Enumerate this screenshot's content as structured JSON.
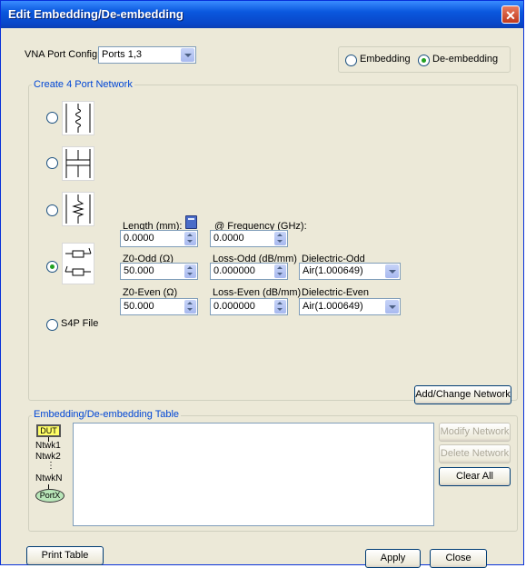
{
  "window": {
    "title": "Edit Embedding/De-embedding",
    "close_glyph": "✕"
  },
  "port_config": {
    "label": "VNA Port Config",
    "value": "Ports 1,3"
  },
  "mode": {
    "embedding_label": "Embedding",
    "deembedding_label": "De-embedding",
    "selected": "De-embedding"
  },
  "create_group": {
    "title": "Create 4 Port Network"
  },
  "topologies": [
    {
      "name": "series-inductor",
      "selected": false
    },
    {
      "name": "shunt-capacitor",
      "selected": false
    },
    {
      "name": "shunt-inductor",
      "selected": false
    },
    {
      "name": "coupled-line",
      "selected": true
    }
  ],
  "s4p_label": "S4P File",
  "fields": {
    "length_label": "Length (mm):",
    "length_value": "0.0000",
    "frequency_label": "@ Frequency (GHz):",
    "frequency_value": "0.0000",
    "z0_odd_label": "Z0-Odd (Ω)",
    "z0_odd_value": "50.000",
    "loss_odd_label": "Loss-Odd (dB/mm)",
    "loss_odd_value": "0.000000",
    "dielectric_odd_label": "Dielectric-Odd",
    "dielectric_odd_value": "Air(1.000649)",
    "z0_even_label": "Z0-Even (Ω)",
    "z0_even_value": "50.000",
    "loss_even_label": "Loss-Even (dB/mm)",
    "loss_even_value": "0.000000",
    "dielectric_even_label": "Dielectric-Even",
    "dielectric_even_value": "Air(1.000649)"
  },
  "add_change_button": "Add/Change Network",
  "table_group": {
    "title": "Embedding/De-embedding Table",
    "diagram": {
      "dut": "DUT",
      "ntwk1": "Ntwk1",
      "ntwk2": "Ntwk2",
      "ntwkn": "NtwkN",
      "portx": "PortX"
    }
  },
  "table_buttons": {
    "modify": "Modify Network",
    "delete": "Delete Network",
    "clear": "Clear All"
  },
  "footer": {
    "print": "Print Table",
    "apply": "Apply",
    "close": "Close"
  },
  "colors": {
    "title_bar": "#0a58de",
    "group_label": "#0046d5",
    "radio_dot": "#21a121",
    "dut_fill": "#ffff66",
    "portx_fill": "#b8e6b8"
  }
}
